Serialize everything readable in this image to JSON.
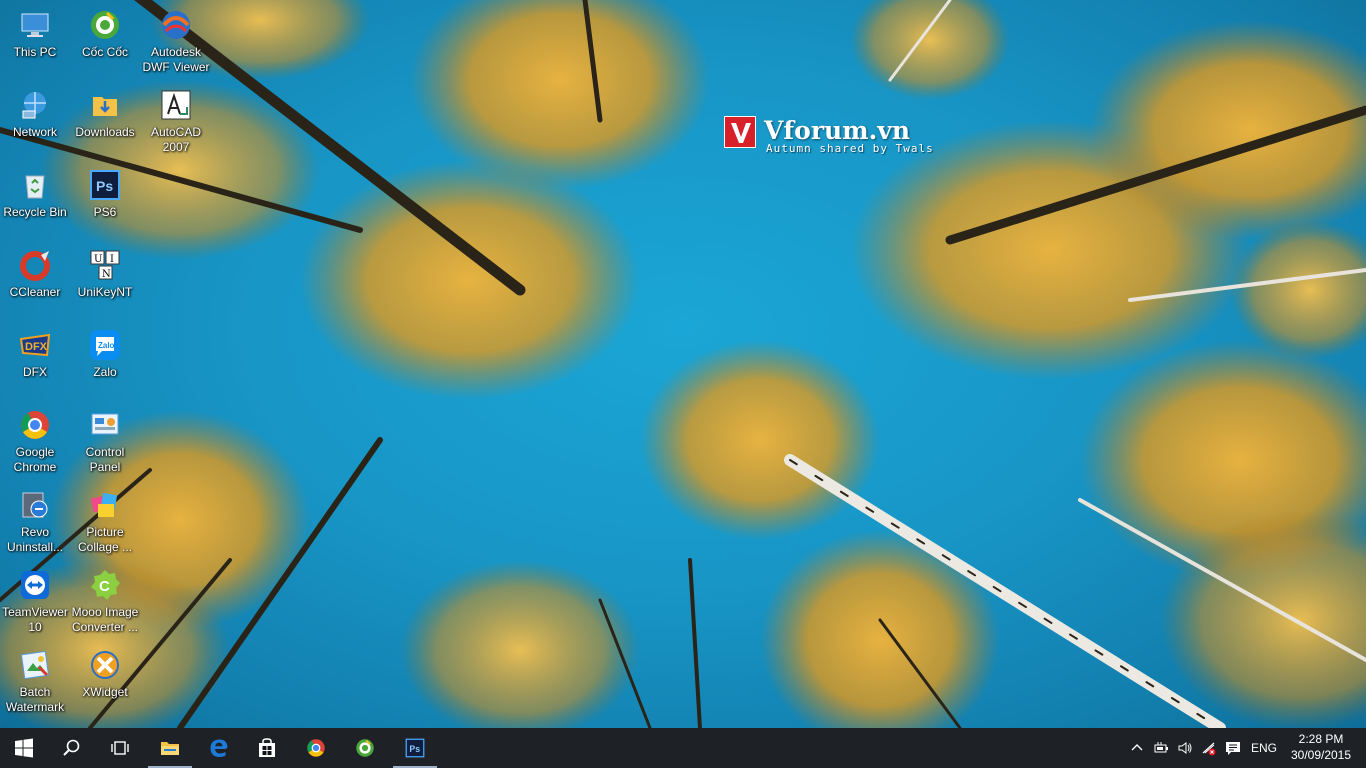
{
  "wallpaper": {
    "brand": "Vforum.vn",
    "caption": "Autumn shared by Twals",
    "colors": {
      "sky": "#1896c6",
      "leaves": "#e6a020",
      "brand_red": "#d8202a"
    }
  },
  "desktop_icons": [
    {
      "label": "This PC",
      "icon": "computer-icon"
    },
    {
      "label": "Cốc Cốc",
      "icon": "coc-coc-browser-icon"
    },
    {
      "label": "Autodesk DWF Viewer",
      "icon": "autodesk-dwf-viewer-icon"
    },
    {
      "label": "Network",
      "icon": "network-icon"
    },
    {
      "label": "Downloads",
      "icon": "downloads-folder-icon"
    },
    {
      "label": "AutoCAD 2007",
      "icon": "autocad-icon"
    },
    {
      "label": "Recycle Bin",
      "icon": "recycle-bin-icon"
    },
    {
      "label": "PS6",
      "icon": "photoshop-icon"
    },
    {
      "label": "CCleaner",
      "icon": "ccleaner-icon"
    },
    {
      "label": "UniKeyNT",
      "icon": "unikey-icon"
    },
    {
      "label": "DFX",
      "icon": "dfx-icon"
    },
    {
      "label": "Zalo",
      "icon": "zalo-icon"
    },
    {
      "label": "Google Chrome",
      "icon": "chrome-icon"
    },
    {
      "label": "Control Panel",
      "icon": "control-panel-icon"
    },
    {
      "label": "Revo Uninstall...",
      "icon": "revo-uninstaller-icon"
    },
    {
      "label": "Picture Collage ...",
      "icon": "picture-collage-icon"
    },
    {
      "label": "TeamViewer 10",
      "icon": "teamviewer-icon"
    },
    {
      "label": "Mooo Image Converter ...",
      "icon": "image-converter-icon"
    },
    {
      "label": "Batch Watermark",
      "icon": "batch-watermark-icon"
    },
    {
      "label": "XWidget",
      "icon": "xwidget-icon"
    }
  ],
  "taskbar": {
    "buttons": [
      {
        "name": "start",
        "icon": "windows-logo-icon",
        "running": false
      },
      {
        "name": "search",
        "icon": "search-icon",
        "running": false
      },
      {
        "name": "task-view",
        "icon": "task-view-icon",
        "running": false
      },
      {
        "name": "file-explorer",
        "icon": "file-explorer-icon",
        "running": true
      },
      {
        "name": "edge",
        "icon": "edge-icon",
        "running": false
      },
      {
        "name": "store",
        "icon": "store-icon",
        "running": false
      },
      {
        "name": "chrome",
        "icon": "chrome-icon",
        "running": false
      },
      {
        "name": "coc-coc",
        "icon": "coc-coc-browser-icon",
        "running": false
      },
      {
        "name": "photoshop",
        "icon": "photoshop-icon",
        "running": true
      }
    ],
    "tray": {
      "icons": [
        "chevron-up-icon",
        "battery-icon",
        "volume-icon",
        "network-wifi-off-icon",
        "action-center-icon"
      ],
      "language": "ENG",
      "time": "2:28 PM",
      "date": "30/09/2015"
    }
  }
}
